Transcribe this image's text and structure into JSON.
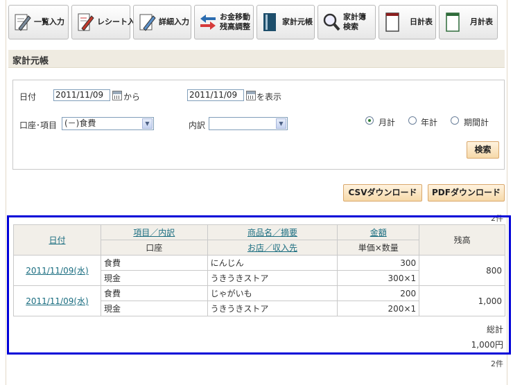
{
  "toolbar": {
    "list_input": "一覧入力",
    "receipt_input": "レシート入力",
    "detail_input": "詳細入力",
    "transfer_l1": "お金移動",
    "transfer_l2": "残高調整",
    "ledger": "家計元帳",
    "search_l1": "家計簿",
    "search_l2": "検索",
    "daily": "日計表",
    "monthly": "月計表"
  },
  "page": {
    "title": "家計元帳"
  },
  "form": {
    "date_label": "日付",
    "date_from": "2011/11/09",
    "from_suffix": "から",
    "date_to": "2011/11/09",
    "to_suffix": "を表示",
    "account_label": "口座･項目",
    "account_value": "(－)食費",
    "detail_label": "内訳",
    "detail_value": "",
    "radio_monthly": "月計",
    "radio_yearly": "年計",
    "radio_period": "期間計",
    "search_button": "検索"
  },
  "downloads": {
    "csv": "CSVダウンロード",
    "pdf": "PDFダウンロード"
  },
  "results": {
    "count_top": "2件",
    "count_bottom": "2件",
    "headers": {
      "date": "日付",
      "item": "項目／内訳",
      "product": "商品名／摘要",
      "amount": "金額",
      "balance": "残高",
      "account": "口座",
      "shop": "お店／収入先",
      "unit": "単価×数量"
    },
    "rows": [
      {
        "date": "2011/11/09(水)",
        "item": "食費",
        "product": "にんじん",
        "amount": "300",
        "account": "現金",
        "shop": "うきうきストア",
        "unit": "300×1",
        "balance": "800"
      },
      {
        "date": "2011/11/09(水)",
        "item": "食費",
        "product": "じゃがいも",
        "amount": "200",
        "account": "現金",
        "shop": "うきうきストア",
        "unit": "200×1",
        "balance": "1,000"
      }
    ],
    "total_label": "総計",
    "total_value": "1,000円"
  },
  "colors": {
    "accent_blue": "#0000d8",
    "button_orange": "#f6d9a9",
    "link": "#1a6d80"
  }
}
